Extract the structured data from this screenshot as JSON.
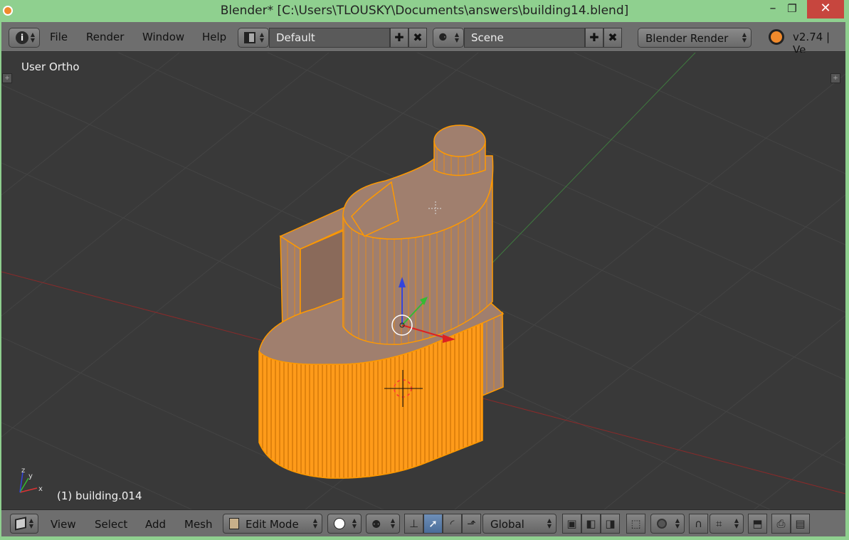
{
  "window": {
    "title": "Blender* [C:\\Users\\TLOUSKY\\Documents\\answers\\building14.blend]",
    "minimize_glyph": "–",
    "maximize_glyph": "❐",
    "close_glyph": "✕"
  },
  "info_header": {
    "menus": [
      "File",
      "Render",
      "Window",
      "Help"
    ],
    "screen_layout": "Default",
    "scene": "Scene",
    "render_engine": "Blender Render",
    "version": "v2.74 | Ve"
  },
  "viewport": {
    "view_name": "User Ortho",
    "active_object": "(1) building.014",
    "axis_labels": {
      "x": "x",
      "y": "y",
      "z": "z"
    },
    "colors": {
      "background": "#393939",
      "grid": "#474747",
      "x_axis": "#8a2a2a",
      "y_axis": "#3f7a3f",
      "mesh_face": "#a07f6e",
      "mesh_edge": "#ff9900"
    }
  },
  "bottom_header": {
    "menus": [
      "View",
      "Select",
      "Add",
      "Mesh"
    ],
    "mode": "Edit Mode",
    "orientation": "Global"
  },
  "icons": {
    "info": "info-icon",
    "blender_logo": "blender-logo-icon",
    "editor_type": "cube-editor-icon"
  }
}
